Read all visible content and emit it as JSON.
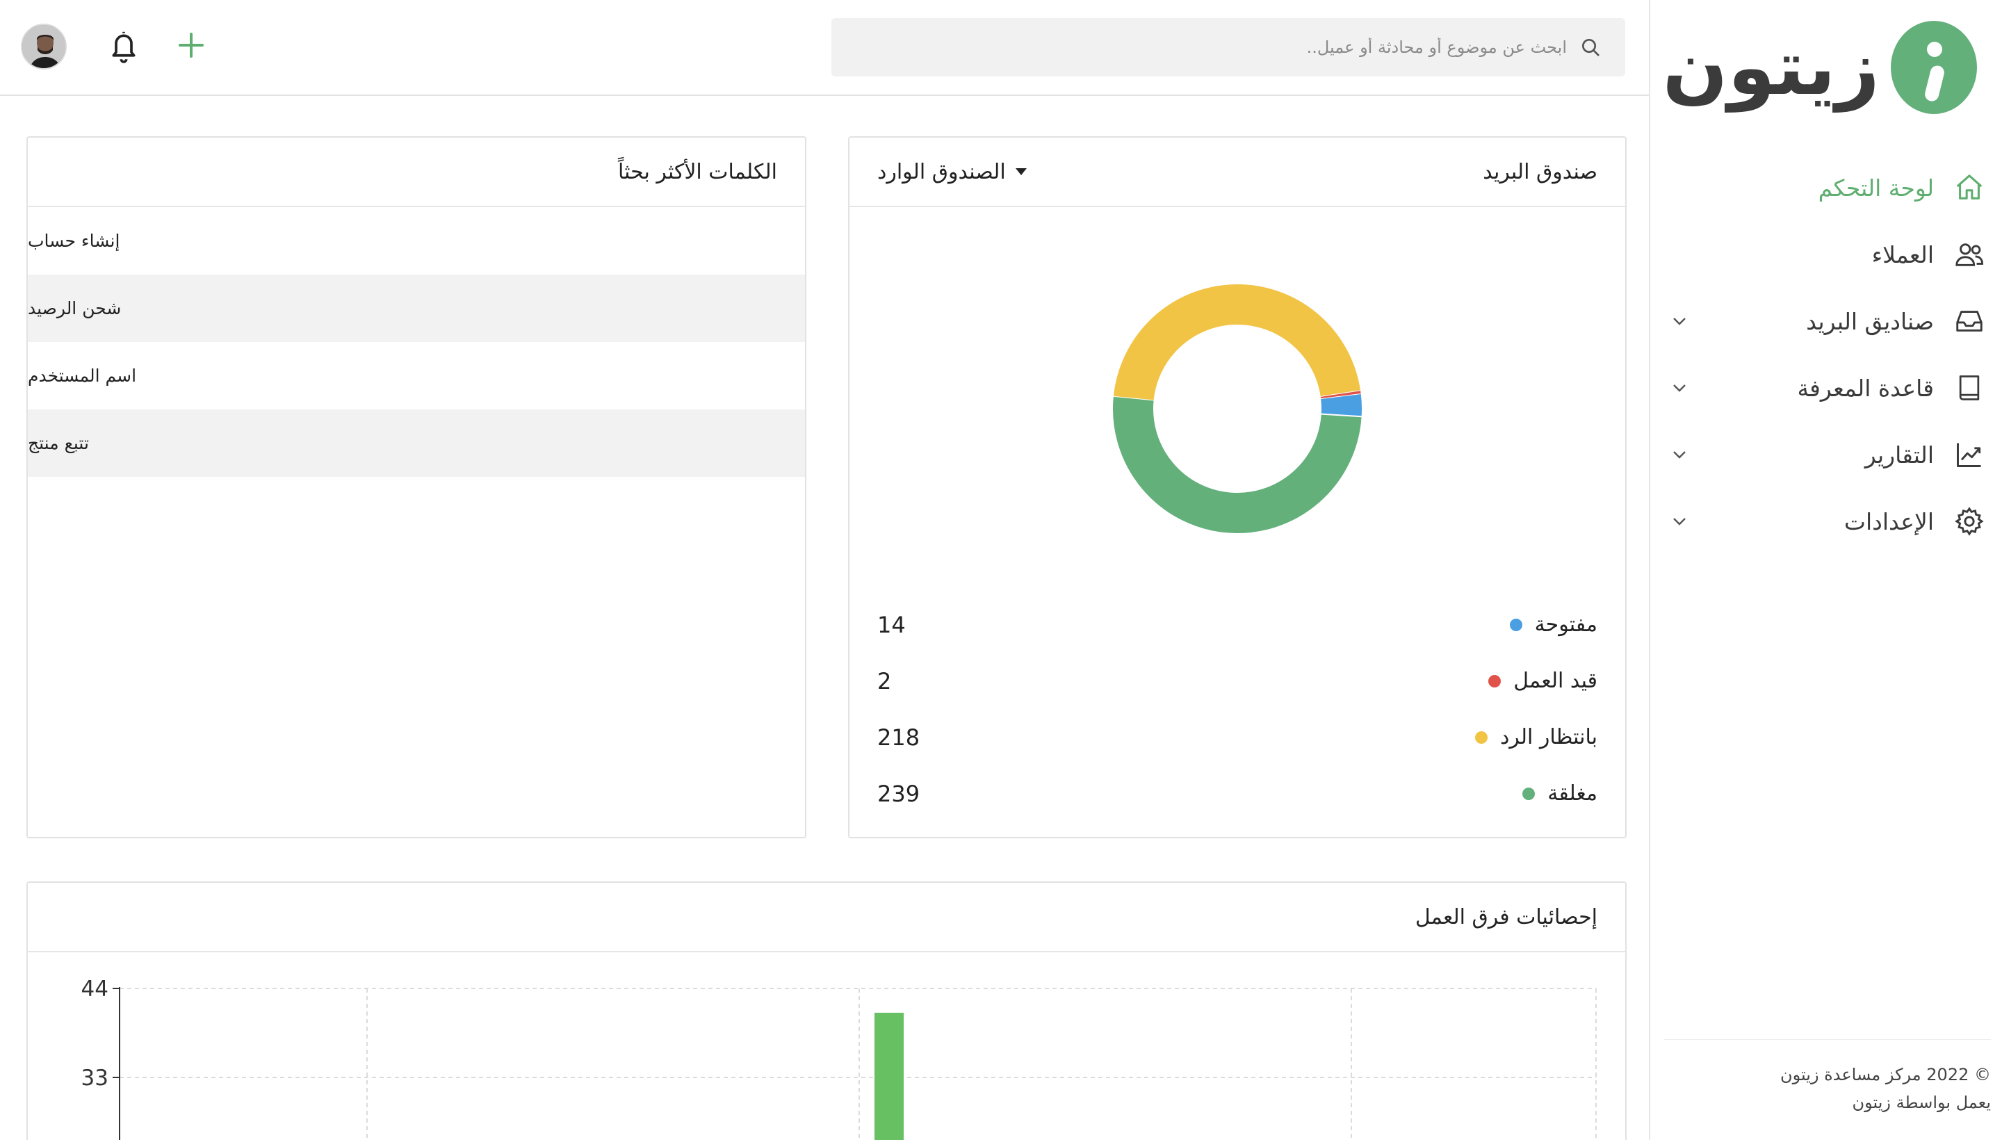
{
  "brand": {
    "name": "زيتون",
    "accent": "#63b07b"
  },
  "sidebar": {
    "items": [
      {
        "label": "لوحة التحكم",
        "icon": "home-icon",
        "active": true,
        "has_chevron": false
      },
      {
        "label": "العملاء",
        "icon": "users-icon",
        "active": false,
        "has_chevron": false
      },
      {
        "label": "صناديق البريد",
        "icon": "inbox-icon",
        "active": false,
        "has_chevron": true
      },
      {
        "label": "قاعدة المعرفة",
        "icon": "book-icon",
        "active": false,
        "has_chevron": true
      },
      {
        "label": "التقارير",
        "icon": "chart-line-icon",
        "active": false,
        "has_chevron": true
      },
      {
        "label": "الإعدادات",
        "icon": "gear-icon",
        "active": false,
        "has_chevron": true
      }
    ],
    "footer": {
      "copyright": "© 2022 مركز مساعدة زيتون",
      "powered_by": "يعمل بواسطة زيتون"
    }
  },
  "topbar": {
    "search_placeholder": "ابحث عن موضوع أو محادثة أو عميل.."
  },
  "mailbox_card": {
    "title": "صندوق البريد",
    "selected_box": "الصندوق الوارد"
  },
  "keywords_card": {
    "title": "الكلمات الأكثر بحثاً",
    "items": [
      "إنشاء حساب",
      "شحن الرصيد",
      "اسم المستخدم",
      "تتبع منتج"
    ]
  },
  "team_card": {
    "title": "إحصائيات فرق العمل"
  },
  "chart_data": [
    {
      "type": "pie",
      "subtype": "donut",
      "labels": [
        "مفتوحة",
        "قيد العمل",
        "بانتظار الرد",
        "مغلقة"
      ],
      "values": [
        14,
        2,
        218,
        239
      ],
      "colors": [
        "#4a9fe3",
        "#e0524a",
        "#f2c446",
        "#63b07b"
      ]
    },
    {
      "type": "bar",
      "ylim": [
        0,
        44
      ],
      "yticks": [
        33,
        44
      ],
      "series": [
        {
          "values": [
            41
          ]
        }
      ],
      "grid": true,
      "color": "#67c062"
    }
  ]
}
